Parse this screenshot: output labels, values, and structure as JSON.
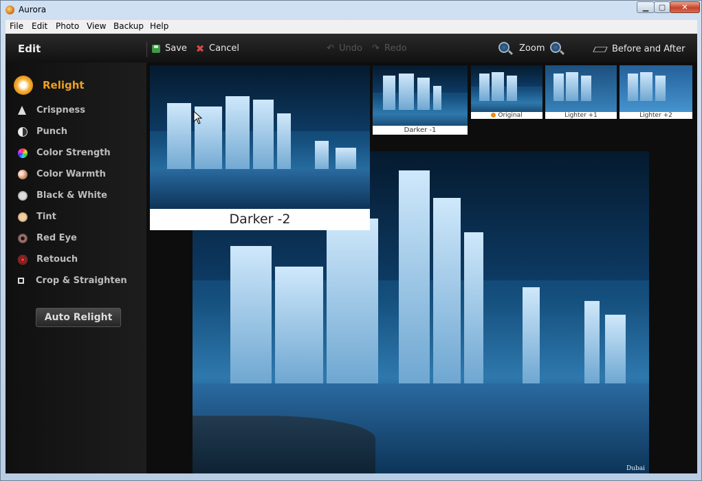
{
  "window": {
    "title": "Aurora",
    "min_glyph": "▁",
    "max_glyph": "▢",
    "close_glyph": "✕"
  },
  "menu": [
    "File",
    "Edit",
    "Photo",
    "View",
    "Backup",
    "Help"
  ],
  "toolbar": {
    "section": "Edit",
    "save": "Save",
    "cancel": "Cancel",
    "undo": "Undo",
    "redo": "Redo",
    "zoom": "Zoom",
    "before_after": "Before and After"
  },
  "sidebar": {
    "items": [
      {
        "label": "Relight",
        "icon": "sun-icon",
        "active": true
      },
      {
        "label": "Crispness",
        "icon": "crispness-icon"
      },
      {
        "label": "Punch",
        "icon": "punch-icon"
      },
      {
        "label": "Color Strength",
        "icon": "color-wheel-icon"
      },
      {
        "label": "Color Warmth",
        "icon": "warmth-icon"
      },
      {
        "label": "Black & White",
        "icon": "black-white-icon"
      },
      {
        "label": "Tint",
        "icon": "tint-icon"
      },
      {
        "label": "Red Eye",
        "icon": "red-eye-icon"
      },
      {
        "label": "Retouch",
        "icon": "target-icon"
      },
      {
        "label": "Crop & Straighten",
        "icon": "crop-icon"
      }
    ],
    "auto_relight": "Auto Relight"
  },
  "thumbnails": [
    {
      "label": "Darker -1"
    },
    {
      "label": "Original"
    },
    {
      "label": "Lighter +1"
    },
    {
      "label": "Lighter +2"
    }
  ],
  "preview": {
    "label": "Darker -2"
  },
  "photo": {
    "watermark": "Dubai"
  }
}
